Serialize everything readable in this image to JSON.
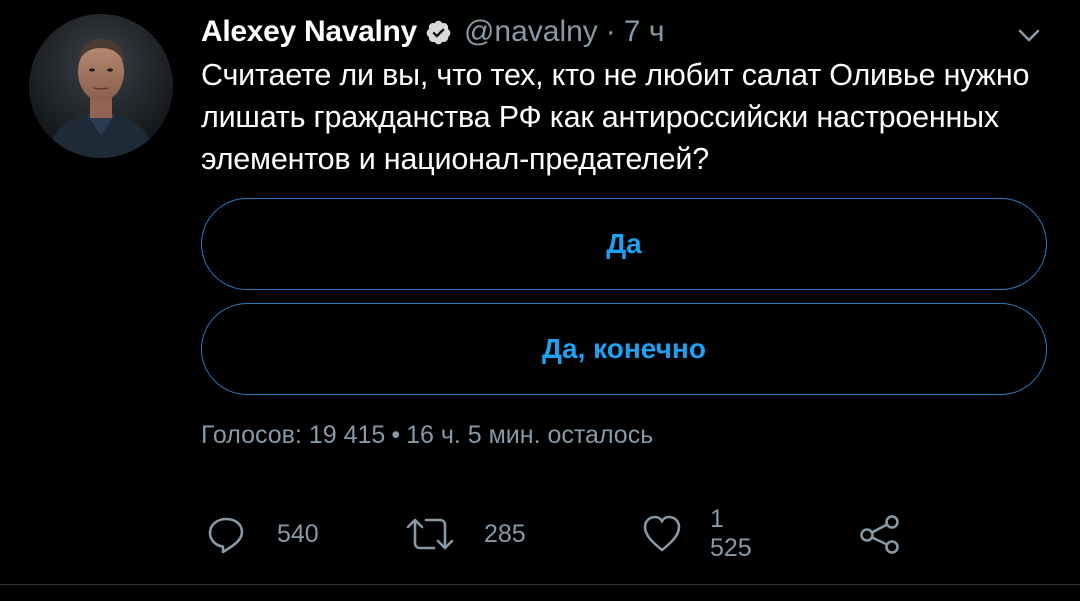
{
  "tweet": {
    "author": {
      "display_name": "Alexey Navalny",
      "verified": true,
      "handle": "@navalny",
      "separator": "·",
      "time": "7 ч"
    },
    "text": "Считаете ли вы, что тех, кто не любит салат Оливье нужно лишать гражданства РФ как антироссийски настроенных элементов и национал-предателей?",
    "poll": {
      "options": [
        {
          "label": "Да"
        },
        {
          "label": "Да, конечно"
        }
      ],
      "votes_label": "Голосов: 19 415",
      "separator": "•",
      "time_left": "16 ч. 5 мин. осталось"
    },
    "actions": {
      "reply_count": "540",
      "retweet_count": "285",
      "like_count": "1 525"
    },
    "colors": {
      "background": "#000000",
      "text": "#ffffff",
      "secondary_text": "#8899a6",
      "accent": "#1da1f2",
      "poll_border": "#2b7bbf"
    },
    "icons": {
      "verified": "verified-badge-icon",
      "caret": "chevron-down-icon",
      "reply": "reply-icon",
      "retweet": "retweet-icon",
      "like": "heart-icon",
      "share": "share-icon"
    }
  }
}
